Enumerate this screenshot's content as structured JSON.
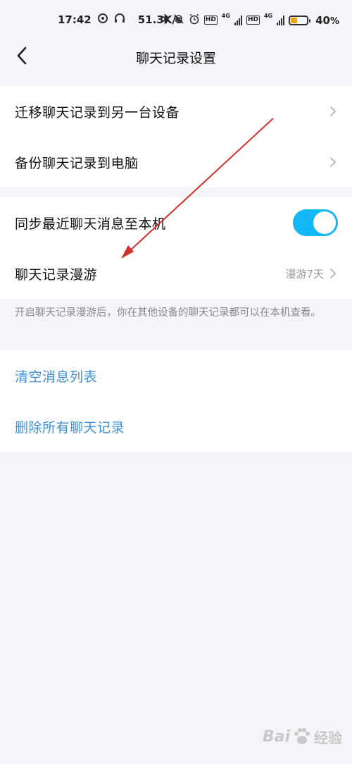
{
  "status_bar": {
    "time": "17:42",
    "net_speed": "51.3K/s",
    "hd1": "HD",
    "hd2": "HD",
    "g4_1": "4G",
    "g4_2": "4G",
    "battery_text": "40",
    "battery_pct_suffix": "%",
    "battery_level": 0.4,
    "battery_color": "#f0a400"
  },
  "nav": {
    "title": "聊天记录设置"
  },
  "section1": {
    "items": [
      {
        "label": "迁移聊天记录到另一台设备"
      },
      {
        "label": "备份聊天记录到电脑"
      }
    ]
  },
  "section2": {
    "sync_label": "同步最近聊天消息至本机",
    "sync_on": true,
    "roam_label": "聊天记录漫游",
    "roam_value": "漫游7天"
  },
  "hint": "开启聊天记录漫游后，你在其他设备的聊天记录都可以在本机查看。",
  "section3": {
    "clear_label": "清空消息列表",
    "delete_label": "删除所有聊天记录"
  },
  "colors": {
    "accent": "#12b7f5",
    "link": "#3e8fd8",
    "annotation_arrow": "#d0312d"
  },
  "watermark": {
    "text_latin": "Bai",
    "text_cn": "经验"
  }
}
